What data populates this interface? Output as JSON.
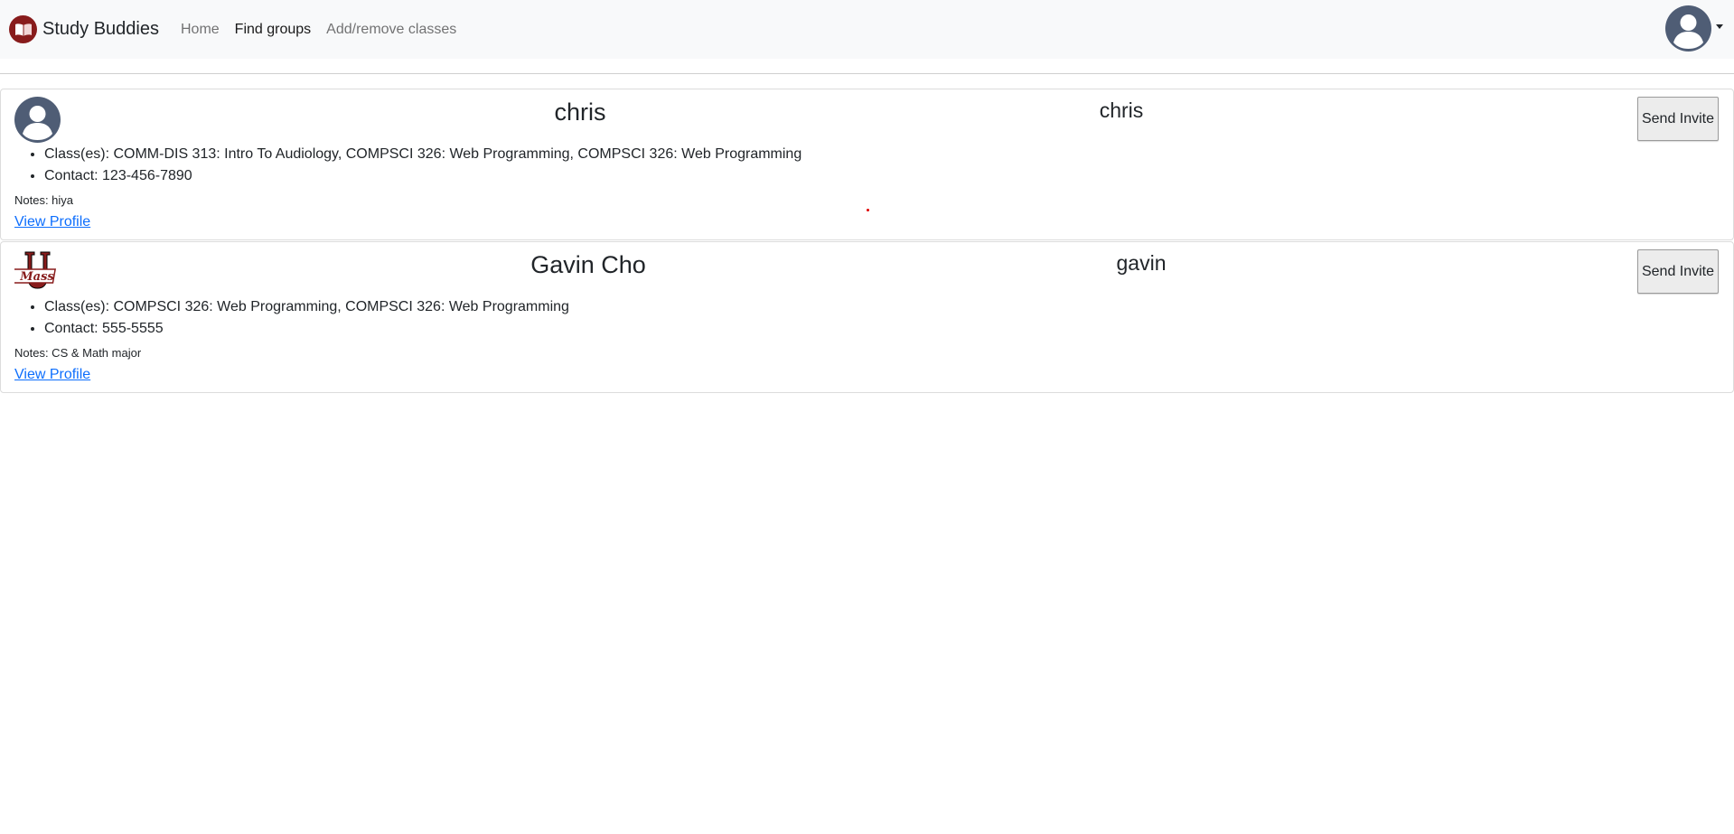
{
  "navbar": {
    "brand": "Study Buddies",
    "links": [
      {
        "label": "Home",
        "active": false
      },
      {
        "label": "Find groups",
        "active": true
      },
      {
        "label": "Add/remove classes",
        "active": false
      }
    ],
    "brand_color": "#881c1c"
  },
  "results": [
    {
      "name": "chris",
      "username": "chris",
      "avatar_icon": "default-user-avatar",
      "classes": "Class(es): COMM-DIS 313: Intro To Audiology, COMPSCI 326: Web Programming, COMPSCI 326: Web Programming",
      "contact": "Contact: 123-456-7890",
      "notes": "Notes: hiya",
      "invite_label": "Send Invite",
      "profile_link": "View Profile"
    },
    {
      "name": "Gavin Cho",
      "username": "gavin",
      "avatar_icon": "umass-logo",
      "classes": "Class(es): COMPSCI 326: Web Programming, COMPSCI 326: Web Programming",
      "contact": "Contact: 555-5555",
      "notes": "Notes: CS & Math major",
      "invite_label": "Send Invite",
      "profile_link": "View Profile"
    }
  ],
  "colors": {
    "link": "#0d6efd",
    "avatar": "#4f5d75",
    "umass_maroon": "#881c1c"
  }
}
